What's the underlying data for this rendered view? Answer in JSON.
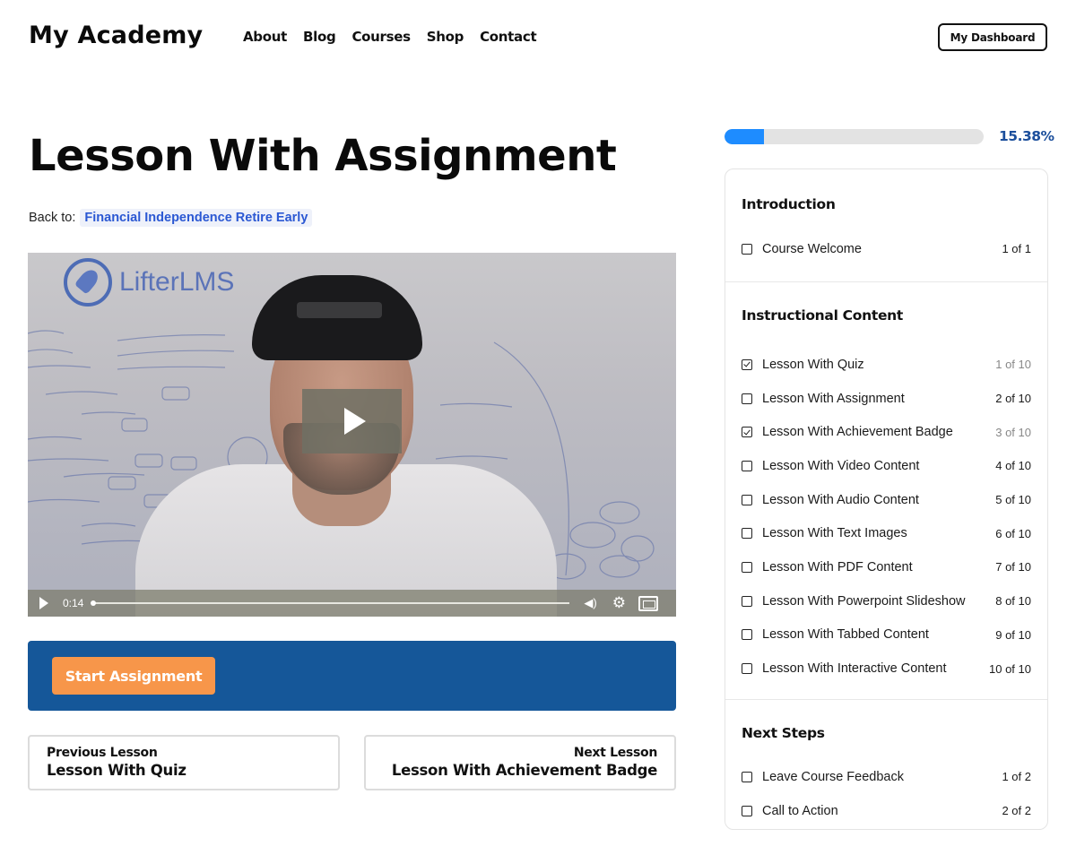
{
  "header": {
    "logo": "My Academy",
    "nav": [
      "About",
      "Blog",
      "Courses",
      "Shop",
      "Contact"
    ],
    "dashboard_button": "My Dashboard"
  },
  "lesson": {
    "title": "Lesson With Assignment",
    "back_label": "Back to:",
    "back_link": "Financial Independence Retire Early"
  },
  "video": {
    "watermark": "LifterLMS",
    "current_time": "0:14",
    "progress_fraction": 0.0,
    "icons": {
      "play": "play-icon",
      "big_play": "play-overlay-icon",
      "volume": "volume-icon",
      "settings": "gear-icon",
      "fullscreen": "fullscreen-icon"
    }
  },
  "assignment": {
    "button_label": "Start Assignment",
    "bar_color": "#155799",
    "button_color": "#f7964a"
  },
  "pagination": {
    "prev_label": "Previous Lesson",
    "prev_title": "Lesson With Quiz",
    "next_label": "Next Lesson",
    "next_title": "Lesson With Achievement Badge"
  },
  "progress": {
    "percent_value": 15.38,
    "percent_text": "15.38%",
    "fill_color": "#1e8cff"
  },
  "syllabus": {
    "sections": [
      {
        "title": "Introduction",
        "lessons": [
          {
            "name": "Course Welcome",
            "count": "1 of 1",
            "complete": false
          }
        ]
      },
      {
        "title": "Instructional Content",
        "lessons": [
          {
            "name": "Lesson With Quiz",
            "count": "1 of 10",
            "complete": true
          },
          {
            "name": "Lesson With Assignment",
            "count": "2 of 10",
            "complete": false
          },
          {
            "name": "Lesson With Achievement Badge",
            "count": "3 of 10",
            "complete": true
          },
          {
            "name": "Lesson With Video Content",
            "count": "4 of 10",
            "complete": false
          },
          {
            "name": "Lesson With Audio Content",
            "count": "5 of 10",
            "complete": false
          },
          {
            "name": "Lesson With Text Images",
            "count": "6 of 10",
            "complete": false
          },
          {
            "name": "Lesson With PDF Content",
            "count": "7 of 10",
            "complete": false
          },
          {
            "name": "Lesson With Powerpoint Slideshow",
            "count": "8 of 10",
            "complete": false
          },
          {
            "name": "Lesson With Tabbed Content",
            "count": "9 of 10",
            "complete": false
          },
          {
            "name": "Lesson With Interactive Content",
            "count": "10 of 10",
            "complete": false
          }
        ]
      },
      {
        "title": "Next Steps",
        "lessons": [
          {
            "name": "Leave Course Feedback",
            "count": "1 of 2",
            "complete": false
          },
          {
            "name": "Call to Action",
            "count": "2 of 2",
            "complete": false
          }
        ]
      }
    ]
  }
}
